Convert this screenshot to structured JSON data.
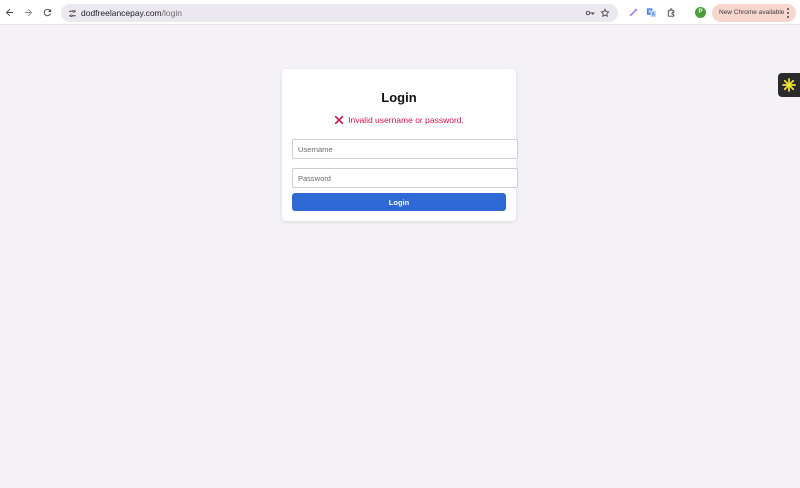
{
  "browser": {
    "url_host": "dodfreelancepay.com",
    "url_path": "/login",
    "profile_initial": "P",
    "update_label": "New Chrome available"
  },
  "icons": {
    "back": "arrow-left-icon",
    "forward": "arrow-right-icon",
    "reload": "reload-icon",
    "site_info": "tune-icon",
    "password_key": "key-icon",
    "bookmark": "star-icon",
    "pen": "pen-icon",
    "translate": "translate-icon",
    "extensions": "puzzle-icon",
    "kebab": "more-vert-icon",
    "extension_badge": "asterisk-icon",
    "error": "x-mark-icon"
  },
  "login": {
    "title": "Login",
    "error_message": "Invalid username or password.",
    "username_placeholder": "Username",
    "username_value": "",
    "password_placeholder": "Password",
    "password_value": "",
    "button_label": "Login"
  },
  "colors": {
    "page_bg": "#f4f2f6",
    "error": "#d3164a",
    "primary_button": "#2e69d6",
    "extension_badge_fg": "#f2e33a"
  }
}
